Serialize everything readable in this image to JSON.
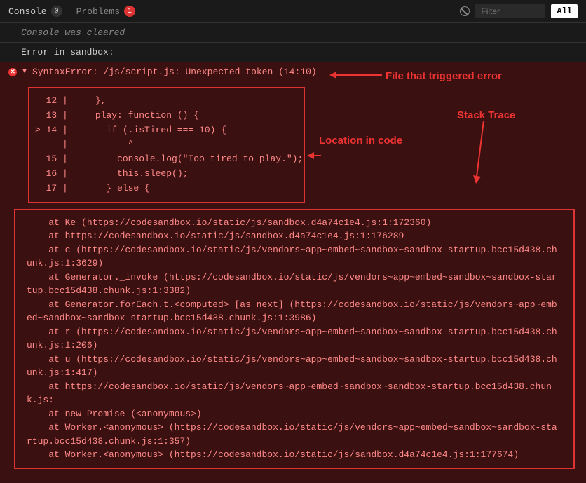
{
  "header": {
    "tabs": [
      {
        "label": "Console",
        "count": "0"
      },
      {
        "label": "Problems",
        "count": "1"
      }
    ],
    "filter_placeholder": "Filter",
    "all_label": "All"
  },
  "cleared_message": "Console was cleared",
  "error_line": "Error in sandbox:",
  "syntax_error": "SyntaxError: /js/script.js: Unexpected token (14:10)",
  "code": {
    "l12": "  12 |     },",
    "l13": "  13 |     play: function () {",
    "l14": "> 14 |       if (.isTired === 10) {",
    "lcaret": "     |           ^",
    "l15": "  15 |         console.log(\"Too tired to play.\");",
    "l16": "  16 |         this.sleep();",
    "l17": "  17 |       } else {"
  },
  "stack": {
    "s1": "    at Ke (https://codesandbox.io/static/js/sandbox.d4a74c1e4.js:1:172360)",
    "s2": "    at https://codesandbox.io/static/js/sandbox.d4a74c1e4.js:1:176289",
    "s3": "    at c (https://codesandbox.io/static/js/vendors~app~embed~sandbox~sandbox-startup.bcc15d438.chunk.js:1:3629)",
    "s4": "    at Generator._invoke (https://codesandbox.io/static/js/vendors~app~embed~sandbox~sandbox-startup.bcc15d438.chunk.js:1:3382)",
    "s5": "    at Generator.forEach.t.<computed> [as next] (https://codesandbox.io/static/js/vendors~app~embed~sandbox~sandbox-startup.bcc15d438.chunk.js:1:3986)",
    "s6": "    at r (https://codesandbox.io/static/js/vendors~app~embed~sandbox~sandbox-startup.bcc15d438.chunk.js:1:206)",
    "s7": "    at u (https://codesandbox.io/static/js/vendors~app~embed~sandbox~sandbox-startup.bcc15d438.chunk.js:1:417)",
    "s8": "    at https://codesandbox.io/static/js/vendors~app~embed~sandbox~sandbox-startup.bcc15d438.chunk.js:",
    "s9": "    at new Promise (<anonymous>)",
    "s10": "    at Worker.<anonymous> (https://codesandbox.io/static/js/vendors~app~embed~sandbox~sandbox-startup.bcc15d438.chunk.js:1:357)",
    "s11": "    at Worker.<anonymous> (https://codesandbox.io/static/js/sandbox.d4a74c1e4.js:1:177674)"
  },
  "annotations": {
    "a1": "File that triggered error",
    "a2": "Location in code",
    "a3": "Stack Trace"
  }
}
